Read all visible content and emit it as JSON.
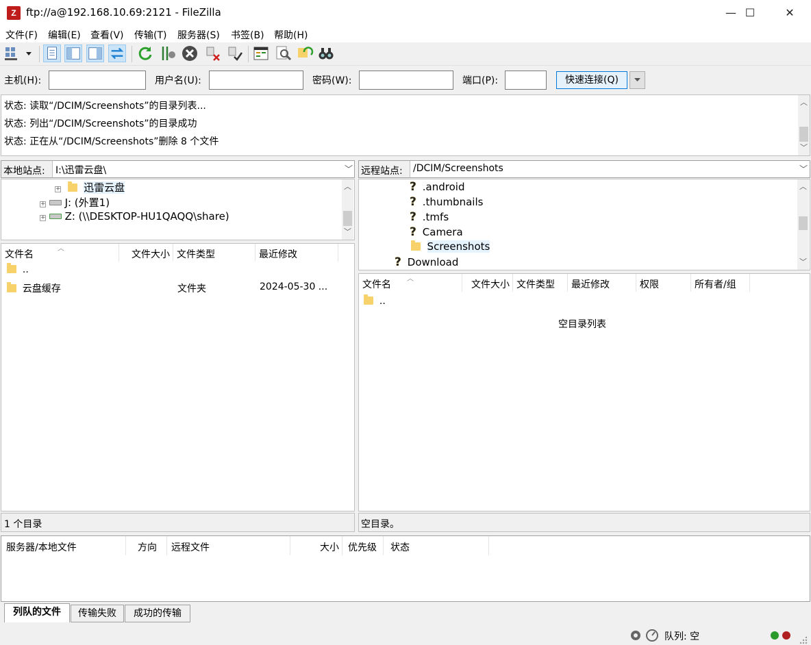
{
  "window": {
    "title": "ftp://a@192.168.10.69:2121 - FileZilla",
    "app_icon_glyph": "Z",
    "controls": {
      "minimize": "—",
      "maximize": "☐",
      "close": "✕"
    }
  },
  "menu": [
    "文件(F)",
    "编辑(E)",
    "查看(V)",
    "传输(T)",
    "服务器(S)",
    "书签(B)",
    "帮助(H)"
  ],
  "toolbar": {
    "icons": [
      "site-manager-icon",
      "message-log-toggle-icon",
      "local-tree-toggle-icon",
      "remote-tree-toggle-icon",
      "transfer-queue-toggle-icon",
      "refresh-icon",
      "process-queue-icon",
      "cancel-icon",
      "disconnect-icon",
      "reconnect-icon",
      "directory-comparison-icon",
      "filter-icon",
      "sync-browse-icon",
      "search-icon"
    ]
  },
  "quickconnect": {
    "host_label": "主机(H):",
    "user_label": "用户名(U):",
    "pass_label": "密码(W):",
    "port_label": "端口(P):",
    "host_value": "",
    "user_value": "",
    "pass_value": "",
    "port_value": "",
    "button": "快速连接(Q)"
  },
  "log": [
    "状态:  读取“/DCIM/Screenshots”的目录列表...",
    "状态:  列出“/DCIM/Screenshots”的目录成功",
    "状态:  正在从“/DCIM/Screenshots”删除 8 个文件"
  ],
  "local": {
    "site_label": "本地站点:",
    "path": "I:\\迅雷云盘\\",
    "tree": [
      {
        "label": "迅雷云盘",
        "kind": "folder"
      },
      {
        "label": "J: (外置1)",
        "kind": "drive"
      },
      {
        "label": "Z: (\\\\DESKTOP-HU1QAQQ\\share)",
        "kind": "net-drive"
      }
    ],
    "columns": [
      "文件名",
      "文件大小",
      "文件类型",
      "最近修改"
    ],
    "rows": [
      {
        "name": "..",
        "size": "",
        "type": "",
        "modified": ""
      },
      {
        "name": "云盘缓存",
        "size": "",
        "type": "文件夹",
        "modified": "2024-05-30 ..."
      }
    ],
    "status": "1 个目录"
  },
  "remote": {
    "site_label": "远程站点:",
    "path": "/DCIM/Screenshots",
    "tree": [
      {
        "label": ".android",
        "kind": "unknown"
      },
      {
        "label": ".thumbnails",
        "kind": "unknown"
      },
      {
        "label": ".tmfs",
        "kind": "unknown"
      },
      {
        "label": "Camera",
        "kind": "unknown"
      },
      {
        "label": "Screenshots",
        "kind": "folder"
      },
      {
        "label": "Download",
        "kind": "unknown"
      }
    ],
    "columns": [
      "文件名",
      "文件大小",
      "文件类型",
      "最近修改",
      "权限",
      "所有者/组"
    ],
    "rows": [
      {
        "name": ".."
      }
    ],
    "empty_message": "空目录列表",
    "status": "空目录。"
  },
  "queue": {
    "columns": [
      "服务器/本地文件",
      "方向",
      "远程文件",
      "大小",
      "优先级",
      "状态"
    ]
  },
  "tabs": [
    "列队的文件",
    "传输失败",
    "成功的传输"
  ],
  "statusbar": {
    "queue_text": "队列: 空"
  }
}
